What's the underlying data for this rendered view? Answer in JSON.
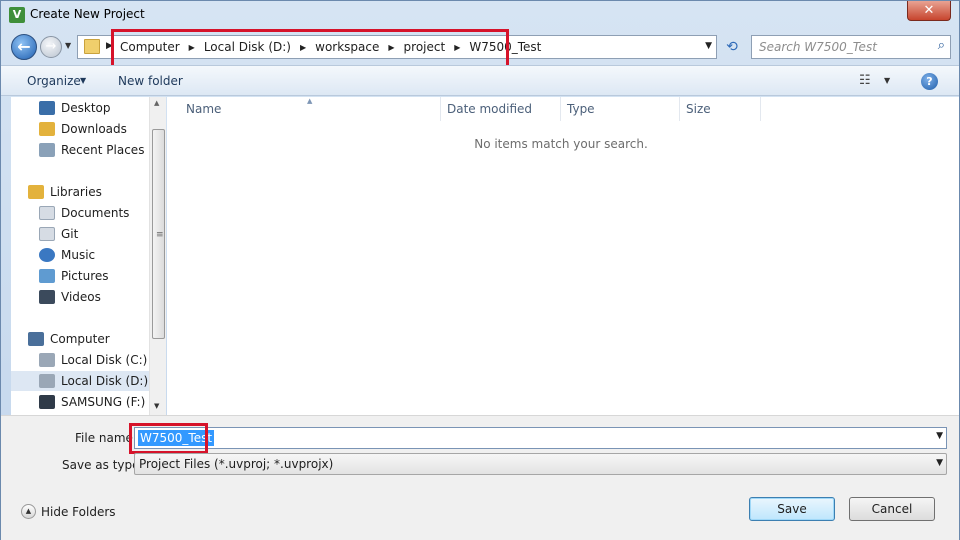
{
  "window": {
    "title": "Create New Project",
    "app_icon_letter": "V",
    "close_glyph": "✕"
  },
  "nav": {
    "back_glyph": "←",
    "forward_glyph": "→",
    "breadcrumbs": [
      "Computer",
      "Local Disk (D:)",
      "workspace",
      "project",
      "W7500_Test"
    ],
    "search_placeholder": "Search W7500_Test"
  },
  "toolbar": {
    "organize_label": "Organize",
    "new_folder_label": "New folder",
    "help_glyph": "?"
  },
  "sidebar": {
    "items": [
      {
        "label": "Desktop",
        "icon": "desktop-icon",
        "color": "#3a6ea8"
      },
      {
        "label": "Downloads",
        "icon": "downloads-icon",
        "color": "#e3b23c"
      },
      {
        "label": "Recent Places",
        "icon": "recent-places-icon",
        "color": "#8aa1b8"
      },
      {
        "label": "Libraries",
        "icon": "libraries-icon",
        "color": "#e3b23c"
      },
      {
        "label": "Documents",
        "icon": "documents-icon",
        "color": "#d6dce4"
      },
      {
        "label": "Git",
        "icon": "git-icon",
        "color": "#d6dce4"
      },
      {
        "label": "Music",
        "icon": "music-icon",
        "color": "#3a78c2"
      },
      {
        "label": "Pictures",
        "icon": "pictures-icon",
        "color": "#5f9bd1"
      },
      {
        "label": "Videos",
        "icon": "videos-icon",
        "color": "#3b4a5c"
      },
      {
        "label": "Computer",
        "icon": "computer-icon",
        "color": "#4a6f9a"
      },
      {
        "label": "Local Disk (C:)",
        "icon": "drive-c-icon",
        "color": "#9aa7b6"
      },
      {
        "label": "Local Disk (D:)",
        "icon": "drive-d-icon",
        "color": "#9aa7b6",
        "selected": true
      },
      {
        "label": "SAMSUNG (F:)",
        "icon": "drive-f-icon",
        "color": "#2f3a48"
      }
    ]
  },
  "columns": {
    "name": "Name",
    "date_modified": "Date modified",
    "type": "Type",
    "size": "Size"
  },
  "content": {
    "empty_message": "No items match your search."
  },
  "form": {
    "file_name_label": "File name:",
    "file_name_value": "W7500_Test",
    "save_as_type_label": "Save as type:",
    "save_as_type_value": "Project Files (*.uvproj; *.uvprojx)"
  },
  "footer": {
    "hide_folders_label": "Hide Folders",
    "save_label": "Save",
    "cancel_label": "Cancel"
  },
  "colors": {
    "highlight": "#d6132a",
    "selection": "#3399ff"
  }
}
